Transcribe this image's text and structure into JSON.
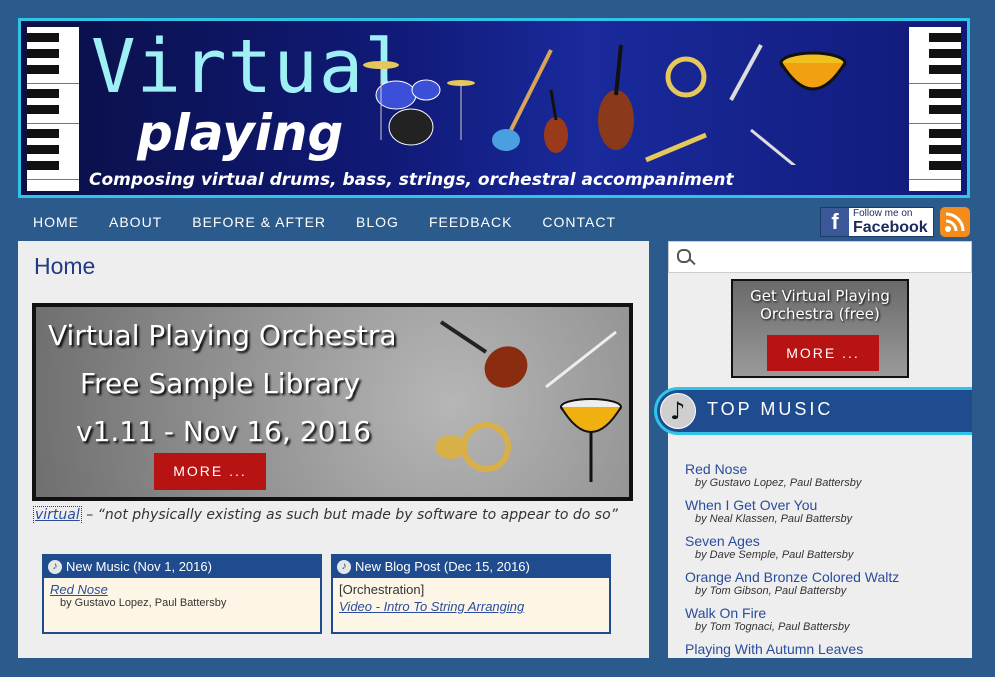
{
  "banner": {
    "title_1": "Virtual",
    "title_2": "playing",
    "tagline": "Composing virtual drums, bass, strings, orchestral accompaniment"
  },
  "nav": {
    "items": [
      "HOME",
      "ABOUT",
      "BEFORE & AFTER",
      "BLOG",
      "FEEDBACK",
      "CONTACT"
    ]
  },
  "social": {
    "facebook_line1": "Follow me on",
    "facebook_line2": "Facebook",
    "facebook_letter": "f"
  },
  "main": {
    "title": "Home",
    "hero": {
      "line1": "Virtual Playing Orchestra",
      "line2": "Free Sample Library",
      "line3": "v1.11 - Nov 16, 2016",
      "button": "MORE ..."
    },
    "definition": {
      "term": "virtual",
      "text": " – “not physically existing as such but made by software to appear to do so”"
    },
    "cards": [
      {
        "heading": "New Music (Nov 1, 2016)",
        "link": "Red Nose",
        "by": "by Gustavo Lopez, Paul Battersby"
      },
      {
        "heading": "New Blog Post (Dec 15, 2016)",
        "tag": "[Orchestration]",
        "link": "Video - Intro To String Arranging"
      }
    ]
  },
  "sidebar": {
    "search_placeholder": "",
    "promo_title": "Get Virtual Playing Orchestra (free)",
    "promo_button": "MORE ...",
    "top_music_label": "TOP MUSIC",
    "tracks": [
      {
        "name": "Red Nose",
        "by": "by Gustavo Lopez, Paul Battersby"
      },
      {
        "name": "When I Get Over You",
        "by": "by Neal Klassen, Paul Battersby"
      },
      {
        "name": "Seven Ages",
        "by": "by Dave Semple, Paul Battersby"
      },
      {
        "name": "Orange And Bronze Colored Waltz",
        "by": "by Tom Gibson, Paul Battersby"
      },
      {
        "name": "Walk On Fire",
        "by": "by Tom Tognaci, Paul Battersby"
      },
      {
        "name": "Playing With Autumn Leaves",
        "by": ""
      }
    ]
  },
  "colors": {
    "background": "#2b5a8c",
    "accent_cyan": "#2fc4e8",
    "button_red": "#b71313",
    "link_blue": "#2a4c9c",
    "card_header": "#1e4c8e"
  }
}
